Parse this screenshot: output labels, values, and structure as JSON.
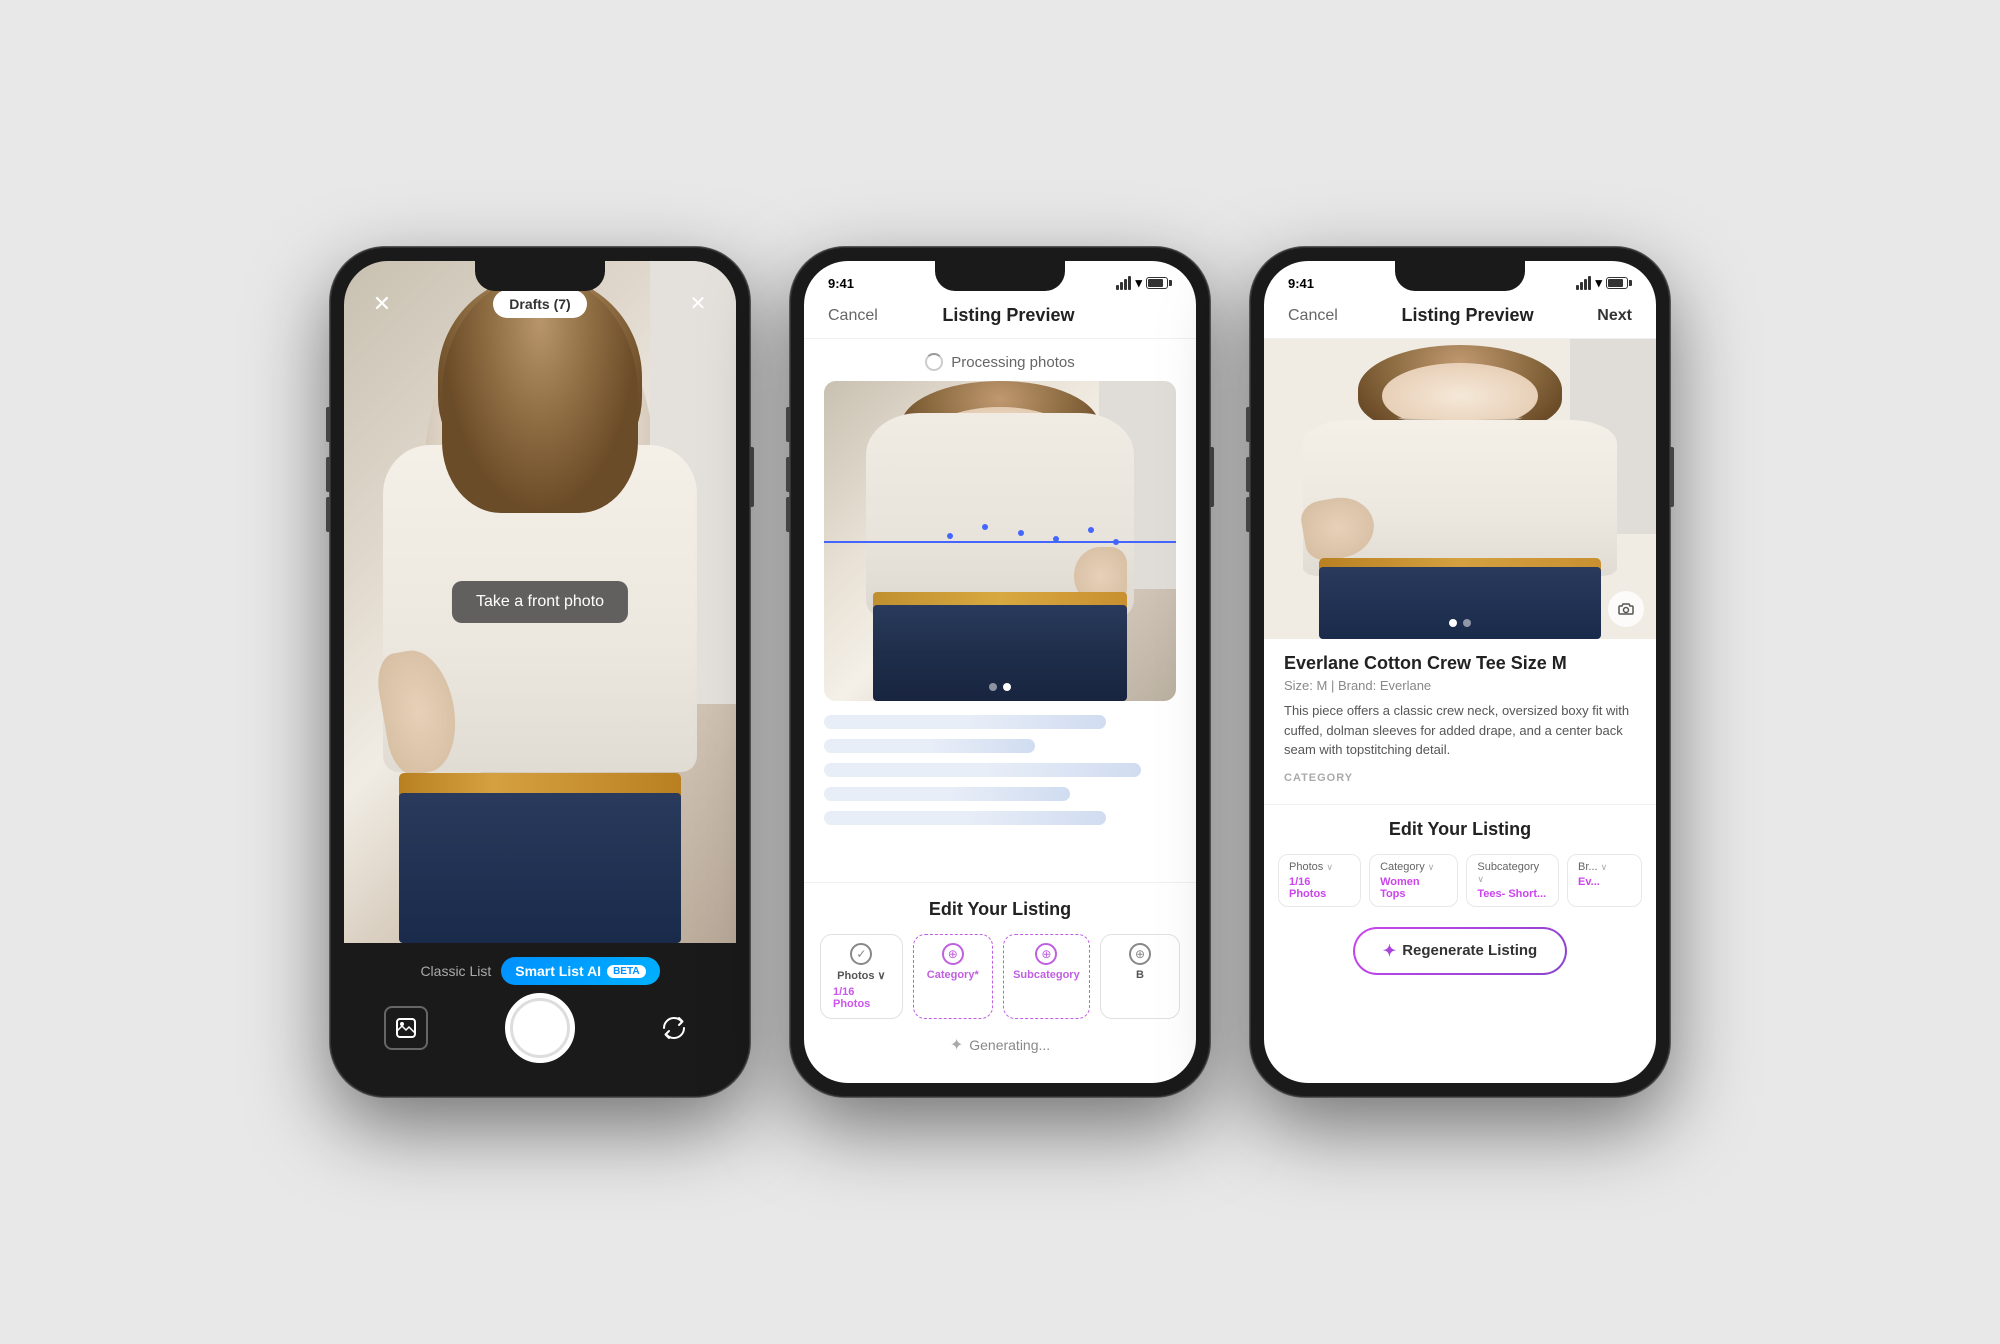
{
  "page": {
    "background": "#e8e8e8"
  },
  "phone1": {
    "camera_x_label": "✕",
    "drafts_label": "Drafts (7)",
    "magic_label": "✕",
    "take_photo_label": "Take a front photo",
    "classic_list_label": "Classic List",
    "smart_list_label": "Smart List AI",
    "beta_label": "BETA",
    "mode": "camera"
  },
  "phone2": {
    "status_time": "9:41",
    "nav_cancel": "Cancel",
    "nav_title": "Listing Preview",
    "processing_label": "Processing photos",
    "dots": [
      {
        "active": true
      },
      {
        "active": false
      }
    ],
    "edit_listing_title": "Edit Your Listing",
    "tabs": [
      {
        "label": "Photos",
        "sublabel": "1/16 Photos",
        "icon": "✓",
        "has_sublabel": true
      },
      {
        "label": "Category*",
        "icon": "⊕",
        "active": true
      },
      {
        "label": "Subcategory",
        "icon": "⊕",
        "active": true
      },
      {
        "label": "B...",
        "icon": "⊕"
      }
    ],
    "generating_label": "Generating..."
  },
  "phone3": {
    "status_time": "9:41",
    "nav_cancel": "Cancel",
    "nav_title": "Listing Preview",
    "nav_next": "Next",
    "listing_title": "Everlane Cotton Crew Tee Size M",
    "listing_meta": "Size: M  |  Brand: Everlane",
    "listing_desc": "This piece offers a classic crew neck, oversized boxy fit with cuffed, dolman sleeves for added drape, and a center back seam with topstitching detail.",
    "category_label": "CATEGORY",
    "edit_listing_title": "Edit Your Listing",
    "tabs": [
      {
        "label": "Photos",
        "sublabel": "1/16 Photos",
        "chevron": "∨"
      },
      {
        "label": "Category",
        "sublabel": "Women Tops",
        "chevron": "∨"
      },
      {
        "label": "Subcategory",
        "sublabel": "Tees- Short...",
        "chevron": "∨"
      },
      {
        "label": "Br...",
        "sublabel": "Ev...",
        "chevron": "∨"
      }
    ],
    "regenerate_label": "Regenerate Listing",
    "regenerate_star": "✦"
  }
}
